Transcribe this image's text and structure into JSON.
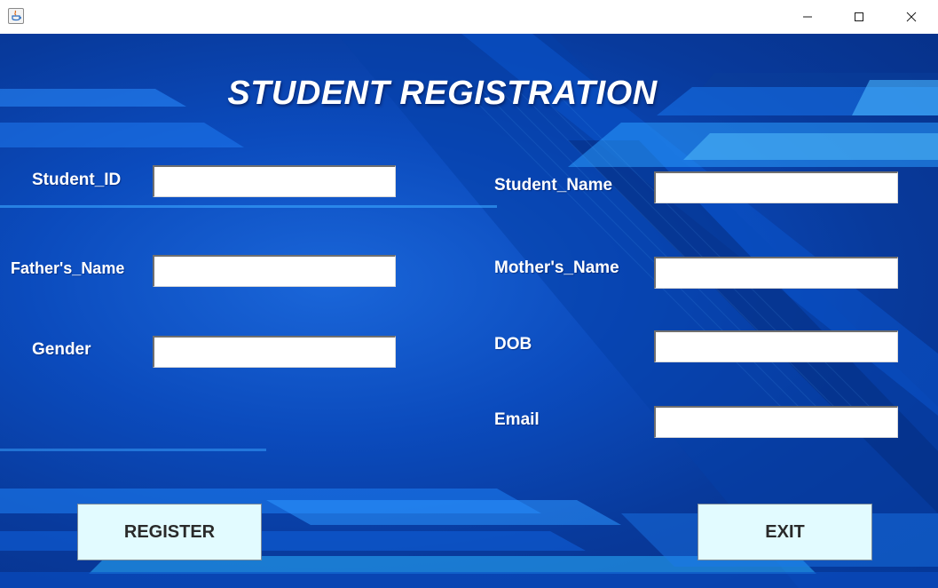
{
  "window": {
    "title": "",
    "app_icon": "java-cup-icon",
    "controls": {
      "minimize_icon": "minimize-icon",
      "maximize_icon": "maximize-icon",
      "close_icon": "close-icon"
    }
  },
  "form": {
    "heading": "STUDENT REGISTRATION",
    "fields": {
      "student_id": {
        "label": "Student_ID",
        "value": ""
      },
      "student_name": {
        "label": "Student_Name",
        "value": ""
      },
      "fathers_name": {
        "label": "Father's_Name",
        "value": ""
      },
      "mothers_name": {
        "label": "Mother's_Name",
        "value": ""
      },
      "gender": {
        "label": "Gender",
        "value": ""
      },
      "dob": {
        "label": "DOB",
        "value": ""
      },
      "email": {
        "label": "Email",
        "value": ""
      }
    },
    "buttons": {
      "register": "REGISTER",
      "exit": "EXIT"
    }
  },
  "colors": {
    "background": "#0b4bbd",
    "button_bg": "#e2fbff",
    "label_text": "#ffffff",
    "accent_cyan": "#2fb3ff"
  }
}
